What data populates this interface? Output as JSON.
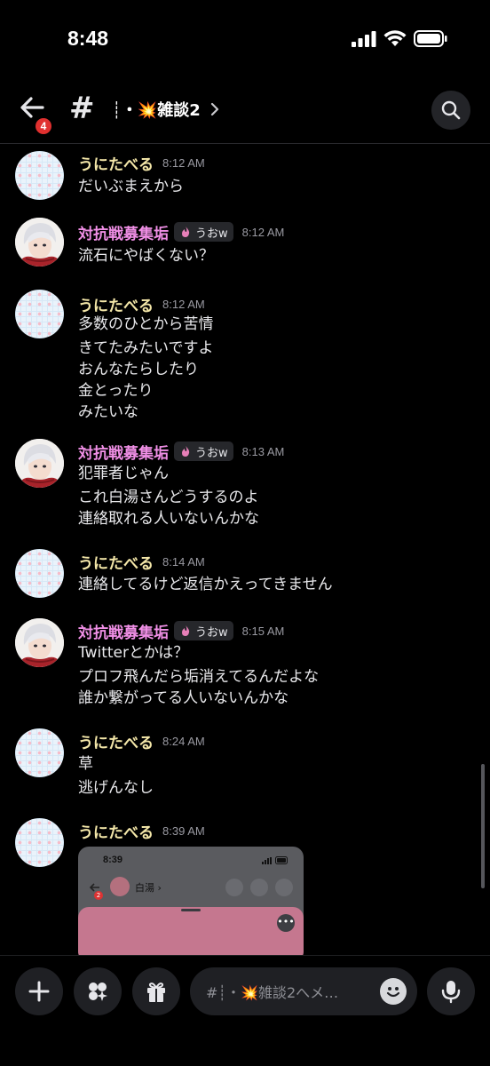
{
  "status_bar": {
    "time": "8:48",
    "signal_icon": "signal-icon",
    "wifi_icon": "wifi-icon",
    "battery_icon": "battery-icon"
  },
  "header": {
    "back_icon": "arrow-left-icon",
    "unread_badge": "4",
    "channel_prefix": "#",
    "channel_name": "┊・💥雑談2",
    "search_icon": "search-icon"
  },
  "messages": [
    {
      "author": "うにたべる",
      "author_color": "#f3e6a8",
      "time": "8:12 AM",
      "text": "だいぶまえから"
    },
    {
      "author": "対抗戦募集垢",
      "author_color": "#f08fe6",
      "tag": "うおw",
      "time": "8:12 AM",
      "text": "流石にやばくない？"
    },
    {
      "author": "うにたべる",
      "author_color": "#f3e6a8",
      "time": "8:12 AM",
      "text": "多数のひとから苦情",
      "text2": "きてたみたいですよ\nおんなたらしたり\n金とったり\nみたいな"
    },
    {
      "author": "対抗戦募集垢",
      "author_color": "#f08fe6",
      "tag": "うおw",
      "time": "8:13 AM",
      "text": "犯罪者じゃん",
      "text2": "これ白湯さんどうするのよ\n連絡取れる人いないんかな"
    },
    {
      "author": "うにたべる",
      "author_color": "#f3e6a8",
      "time": "8:14 AM",
      "text": "連絡してるけど返信かえってきません"
    },
    {
      "author": "対抗戦募集垢",
      "author_color": "#f08fe6",
      "tag": "うおw",
      "time": "8:15 AM",
      "text": "Twitterとかは？",
      "text2": "プロフ飛んだら垢消えてるんだよな\n誰か繋がってる人いないんかな"
    },
    {
      "author": "うにたべる",
      "author_color": "#f3e6a8",
      "time": "8:24 AM",
      "text": "草",
      "text2": "逃げんなし"
    },
    {
      "author": "うにたべる",
      "author_color": "#f3e6a8",
      "time": "8:39 AM"
    }
  ],
  "embed": {
    "time": "8:39",
    "contact_name": "白湯 ›",
    "badge": "2"
  },
  "composer": {
    "placeholder": "#┊・💥雑談2へメ…",
    "plus_icon": "plus-icon",
    "apps_icon": "apps-icon",
    "gift_icon": "gift-icon",
    "emoji_icon": "emoji-icon",
    "mic_icon": "microphone-icon"
  }
}
